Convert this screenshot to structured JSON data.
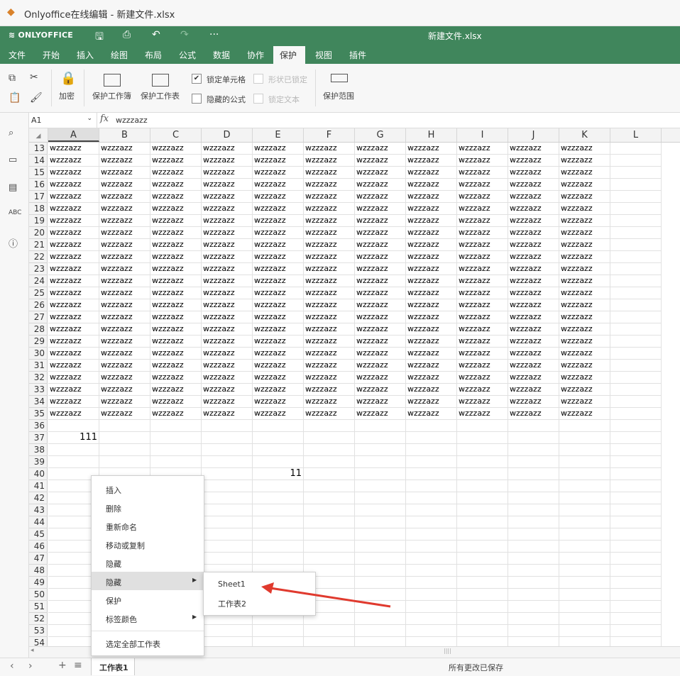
{
  "os_title": "Onlyoffice在线编辑 - 新建文件.xlsx",
  "app": {
    "logo": "ONLYOFFICE",
    "doc_title": "新建文件.xlsx"
  },
  "tabs": [
    "文件",
    "开始",
    "插入",
    "绘图",
    "布局",
    "公式",
    "数据",
    "协作",
    "保护",
    "视图",
    "插件"
  ],
  "active_tab": "保护",
  "toolbar": {
    "encrypt": "加密",
    "protect_workbook": "保护工作簿",
    "protect_sheet": "保护工作表",
    "lock_cell": "锁定单元格",
    "shape_locked": "形状已锁定",
    "hidden_formula": "隐藏的公式",
    "lock_text": "锁定文本",
    "protect_range": "保护范围",
    "lock_cell_checked": true
  },
  "formula_bar": {
    "cell_ref": "A1",
    "fx": "fx",
    "value": "wzzzazz"
  },
  "columns": [
    "A",
    "B",
    "C",
    "D",
    "E",
    "F",
    "G",
    "H",
    "I",
    "J",
    "K",
    "L"
  ],
  "selected_column": "A",
  "rows": {
    "data_row_numbers": [
      "13",
      "14",
      "15",
      "16",
      "17",
      "18",
      "19",
      "20",
      "21",
      "22",
      "23",
      "24",
      "25",
      "26",
      "27",
      "28",
      "29",
      "30",
      "31",
      "32",
      "33",
      "34",
      "35"
    ],
    "empty_row_numbers": [
      "36",
      "37",
      "38",
      "39",
      "40",
      "41",
      "42",
      "43",
      "44",
      "45",
      "46",
      "47",
      "48",
      "49",
      "50",
      "51",
      "52",
      "53",
      "54"
    ],
    "cell_text": "wzzzazz",
    "filled_columns": 11
  },
  "special_cells": [
    {
      "row": "37",
      "col": "A",
      "value": "111"
    },
    {
      "row": "40",
      "col": "E",
      "value": "11"
    }
  ],
  "context_menu": {
    "items": [
      "插入",
      "删除",
      "重新命名",
      "移动或复制",
      "隐藏",
      "隐藏",
      "保护",
      "标签颜色",
      "选定全部工作表"
    ],
    "highlighted": "隐藏"
  },
  "submenu": {
    "items": [
      "Sheet1",
      "工作表2"
    ]
  },
  "bottom": {
    "sheet_tab": "工作表1",
    "status": "所有更改已保存"
  },
  "colors": {
    "brand": "#40865c",
    "arrow": "#e03a2e"
  }
}
